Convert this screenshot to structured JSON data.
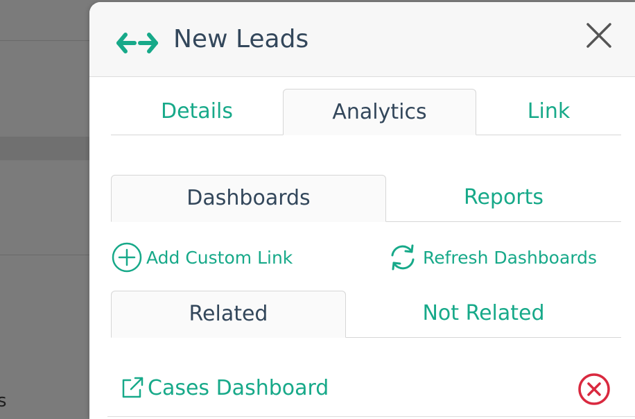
{
  "background": {
    "partial_text": "s"
  },
  "panel": {
    "title": "New Leads",
    "title_icon": "left-right-arrows-icon",
    "close_icon": "close-icon"
  },
  "main_tabs": [
    {
      "label": "Details",
      "active": false
    },
    {
      "label": "Analytics",
      "active": true
    },
    {
      "label": "Link",
      "active": false
    }
  ],
  "analytics_tabs": [
    {
      "label": "Dashboards",
      "active": true
    },
    {
      "label": "Reports",
      "active": false
    }
  ],
  "actions": {
    "add_custom_link": {
      "label": "Add Custom Link",
      "icon": "plus-circle-icon"
    },
    "refresh_dashboards": {
      "label": "Refresh Dashboards",
      "icon": "refresh-icon"
    }
  },
  "relation_tabs": [
    {
      "label": "Related",
      "active": true
    },
    {
      "label": "Not Related",
      "active": false
    }
  ],
  "dashboards": [
    {
      "name": "Cases Dashboard",
      "icon": "external-link-icon",
      "remove_icon": "remove-circle-icon"
    }
  ],
  "colors": {
    "accent": "#17a989",
    "title": "#33475b",
    "danger": "#d9293f",
    "overlay": "#7b7b7b"
  }
}
